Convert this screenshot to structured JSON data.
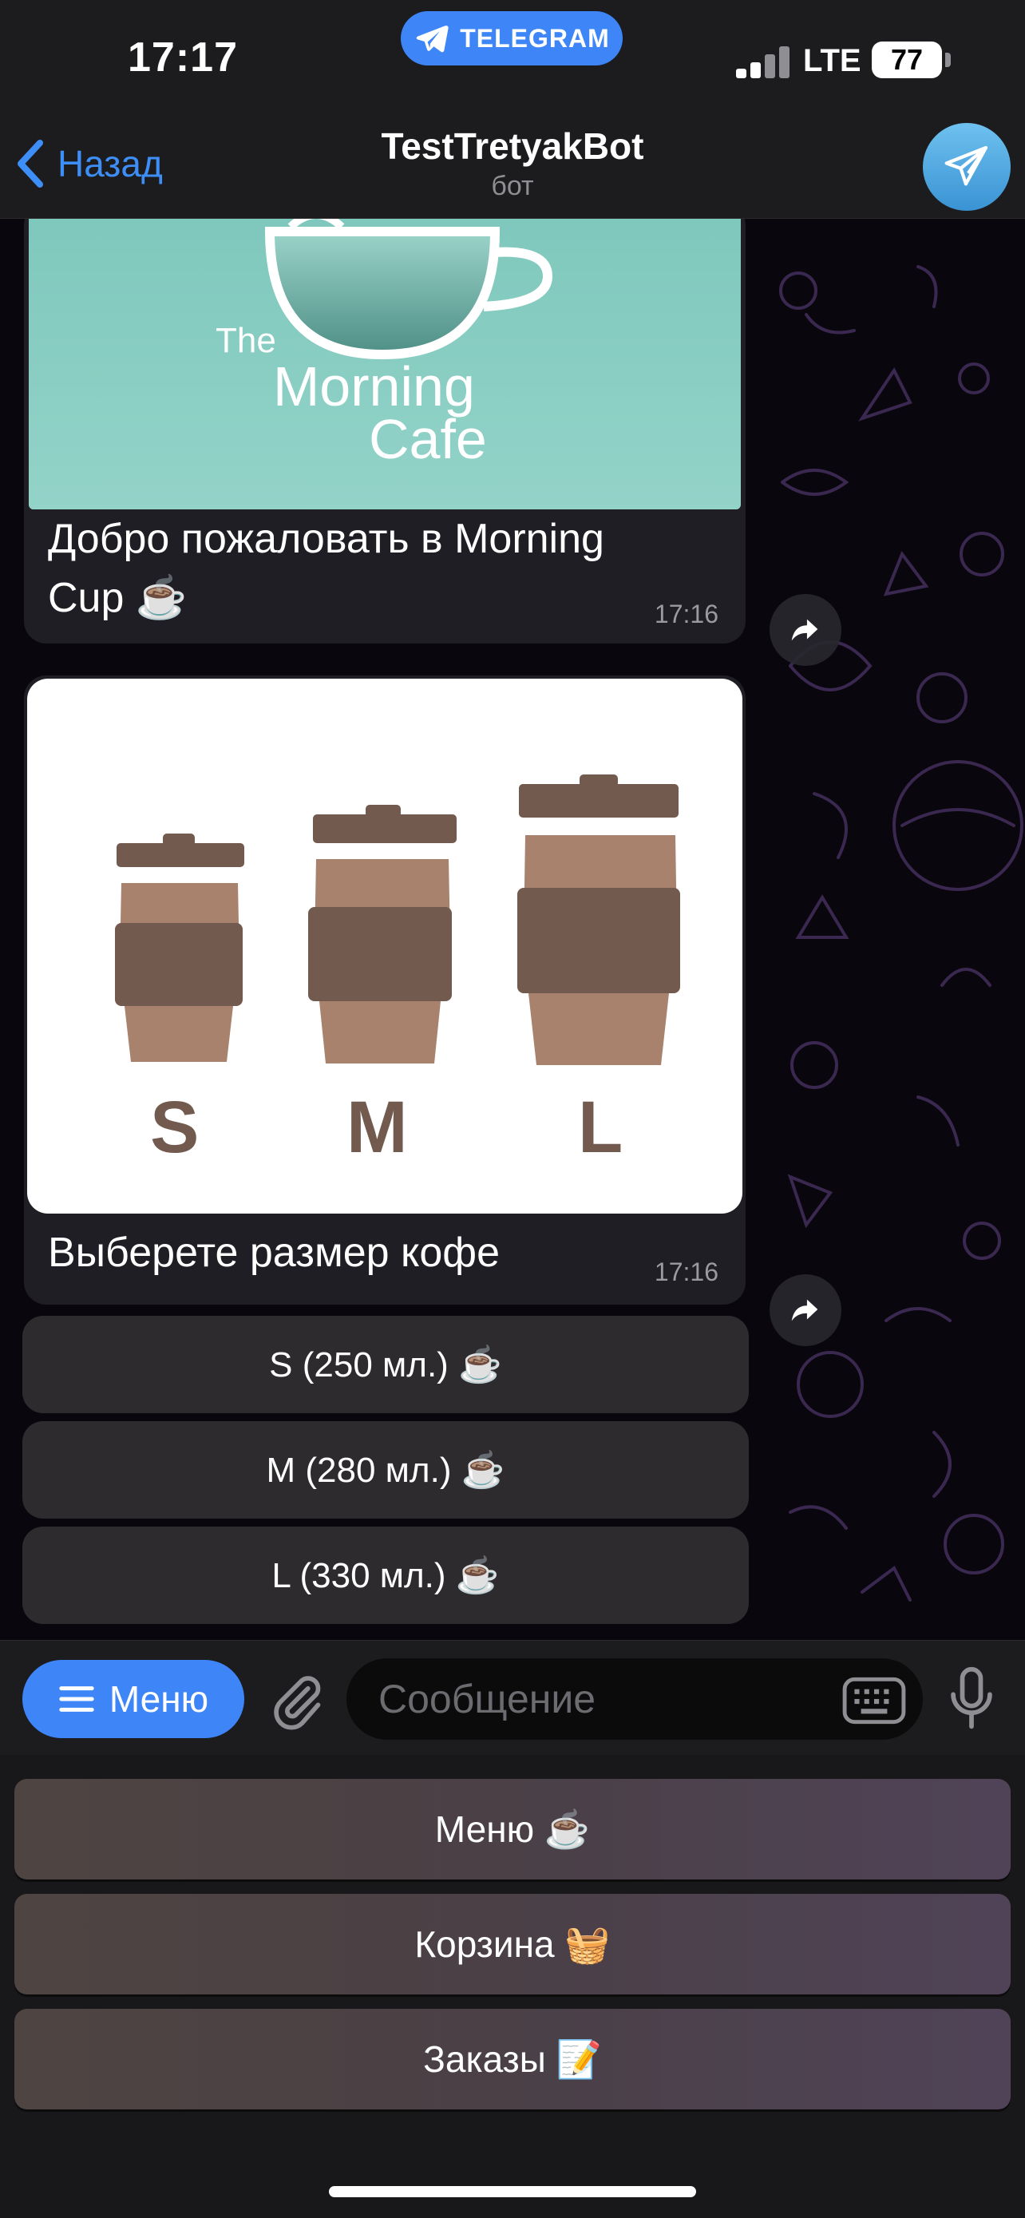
{
  "status_bar": {
    "time": "17:17",
    "app_pill": "TELEGRAM",
    "network": "LTE",
    "battery": "77",
    "battery_level": 0.77
  },
  "nav": {
    "back_label": "Назад",
    "title": "TestTretyakBot",
    "subtitle": "бот",
    "avatar_icon": "paper-plane-icon"
  },
  "messages": [
    {
      "image": {
        "kind": "cafe-logo",
        "text_the": "The",
        "text_morning": "Morning",
        "text_cafe": "Cafe"
      },
      "caption": "Добро пожаловать в Morning Cup ☕️",
      "time": "17:16"
    },
    {
      "image": {
        "kind": "cup-sizes",
        "labels": [
          "S",
          "M",
          "L"
        ]
      },
      "caption": "Выберете размер кофе",
      "time": "17:16"
    }
  ],
  "inline_buttons": [
    {
      "label": "S (250 мл.) ☕️"
    },
    {
      "label": "M (280 мл.) ☕️"
    },
    {
      "label": "L (330 мл.) ☕️"
    }
  ],
  "input_bar": {
    "menu_label": "Меню",
    "placeholder": "Сообщение"
  },
  "reply_keyboard": [
    {
      "label": "Меню ☕️"
    },
    {
      "label": "Корзина 🧺"
    },
    {
      "label": "Заказы 📝"
    }
  ],
  "colors": {
    "accent": "#3e86f7",
    "bubble": "#1f1e24",
    "cafe_bg": "#8ccfc5",
    "cup_dark": "#735a4e",
    "cup_light": "#a8826c"
  }
}
